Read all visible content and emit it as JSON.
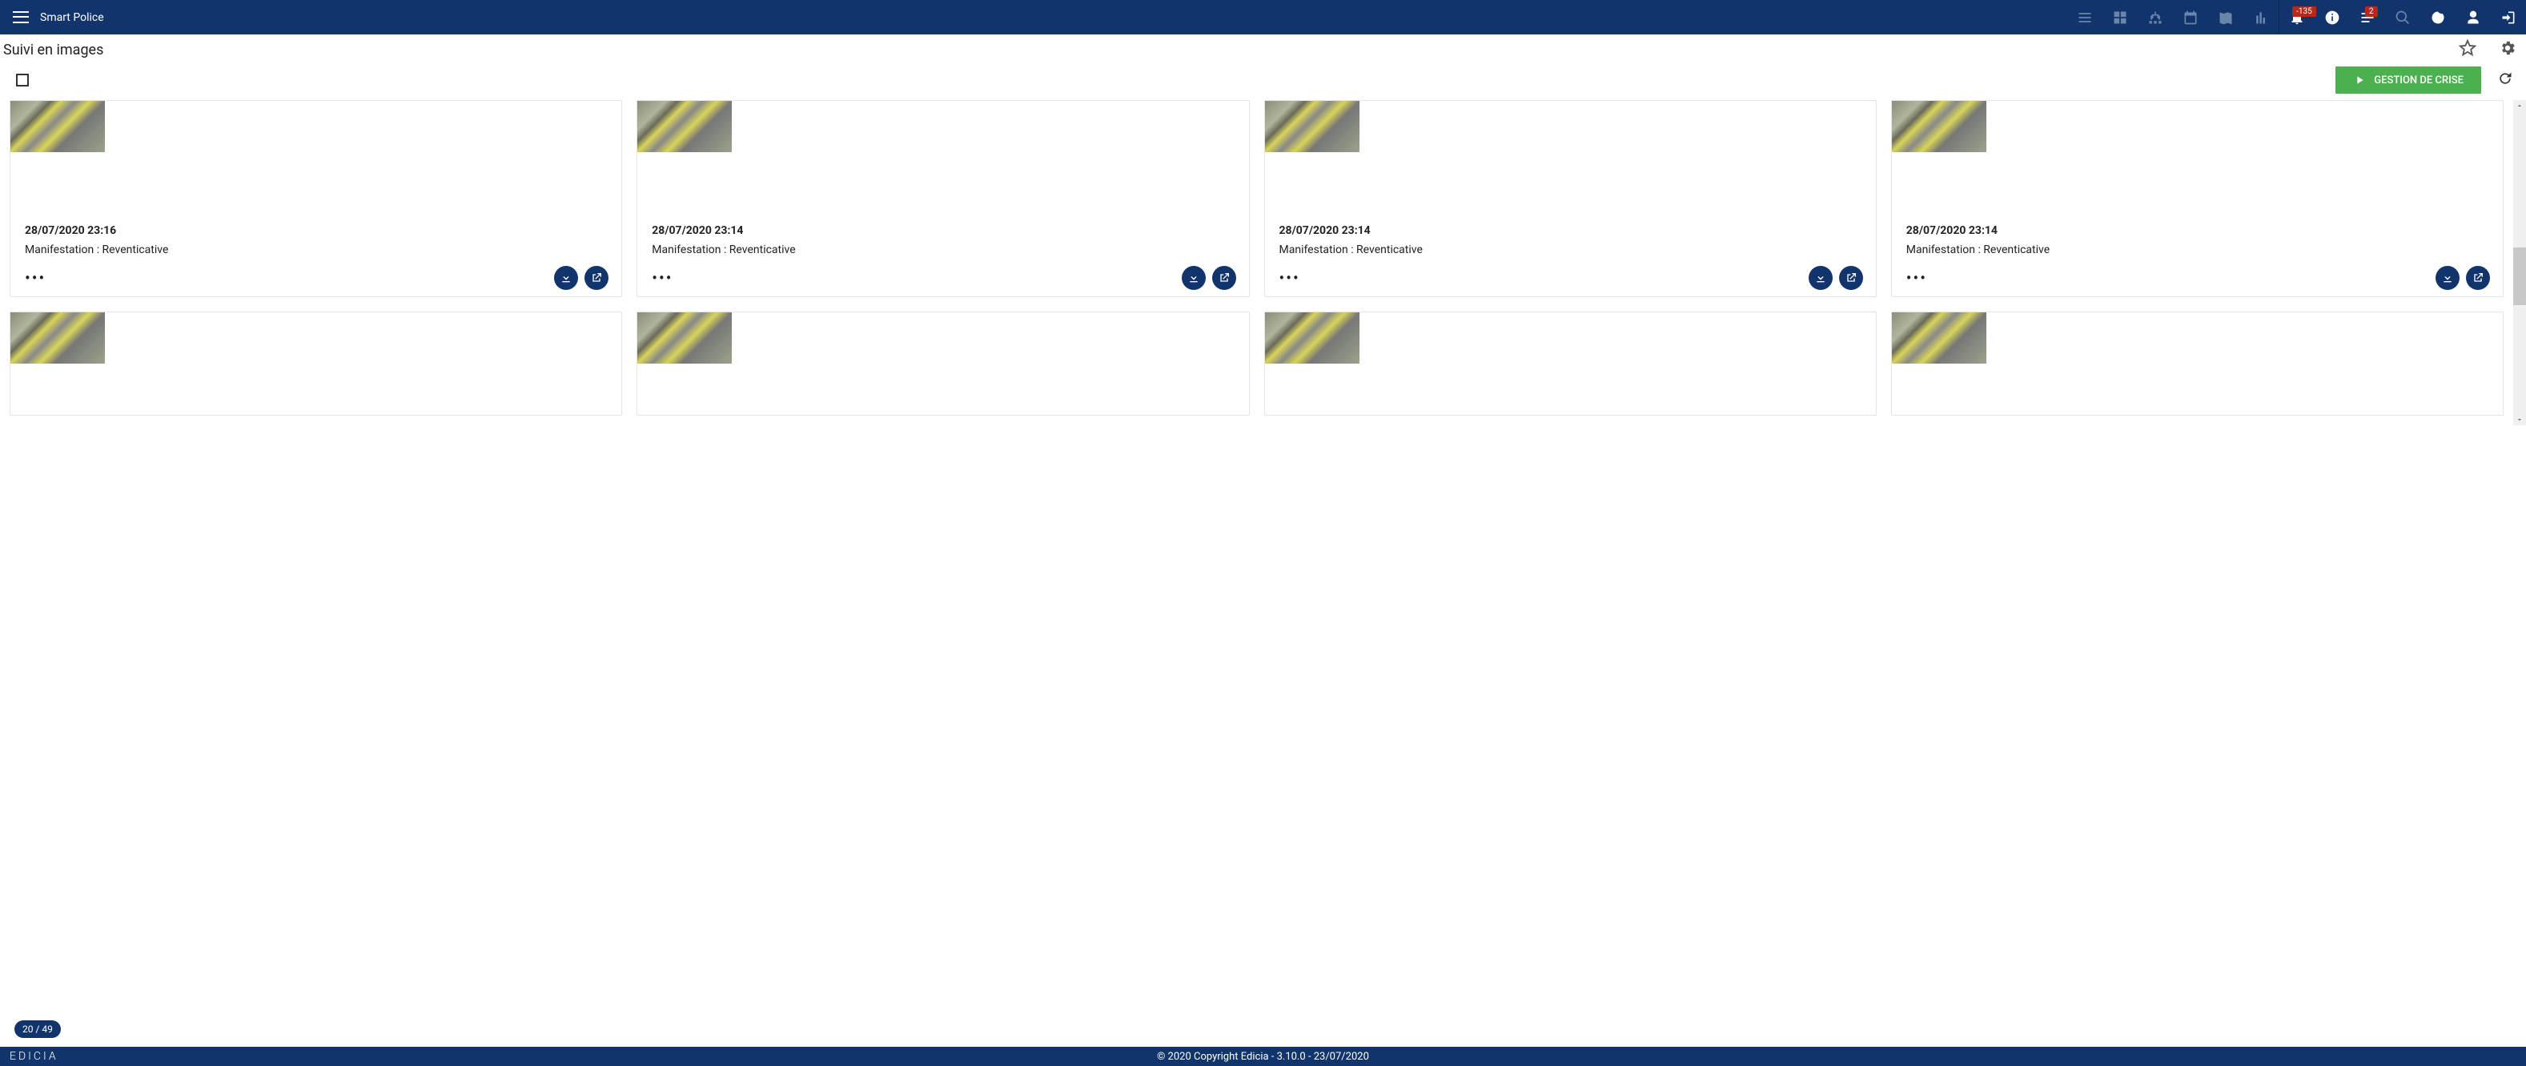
{
  "header": {
    "app_title": "Smart Police",
    "badge1": "-135",
    "badge2": "2"
  },
  "page": {
    "title": "Suivi en images"
  },
  "toolbar": {
    "crisis_label": "GESTION DE CRISE"
  },
  "cards_row1": [
    {
      "date": "28/07/2020 23:16",
      "desc": "Manifestation : Reventicative"
    },
    {
      "date": "28/07/2020 23:14",
      "desc": "Manifestation : Reventicative"
    },
    {
      "date": "28/07/2020 23:14",
      "desc": "Manifestation : Reventicative"
    },
    {
      "date": "28/07/2020 23:14",
      "desc": "Manifestation : Reventicative"
    }
  ],
  "pager": {
    "label": "20 / 49"
  },
  "footer": {
    "logo": "EDICIA",
    "copy": "© 2020 Copyright Edicia - 3.10.0 - 23/07/2020"
  }
}
